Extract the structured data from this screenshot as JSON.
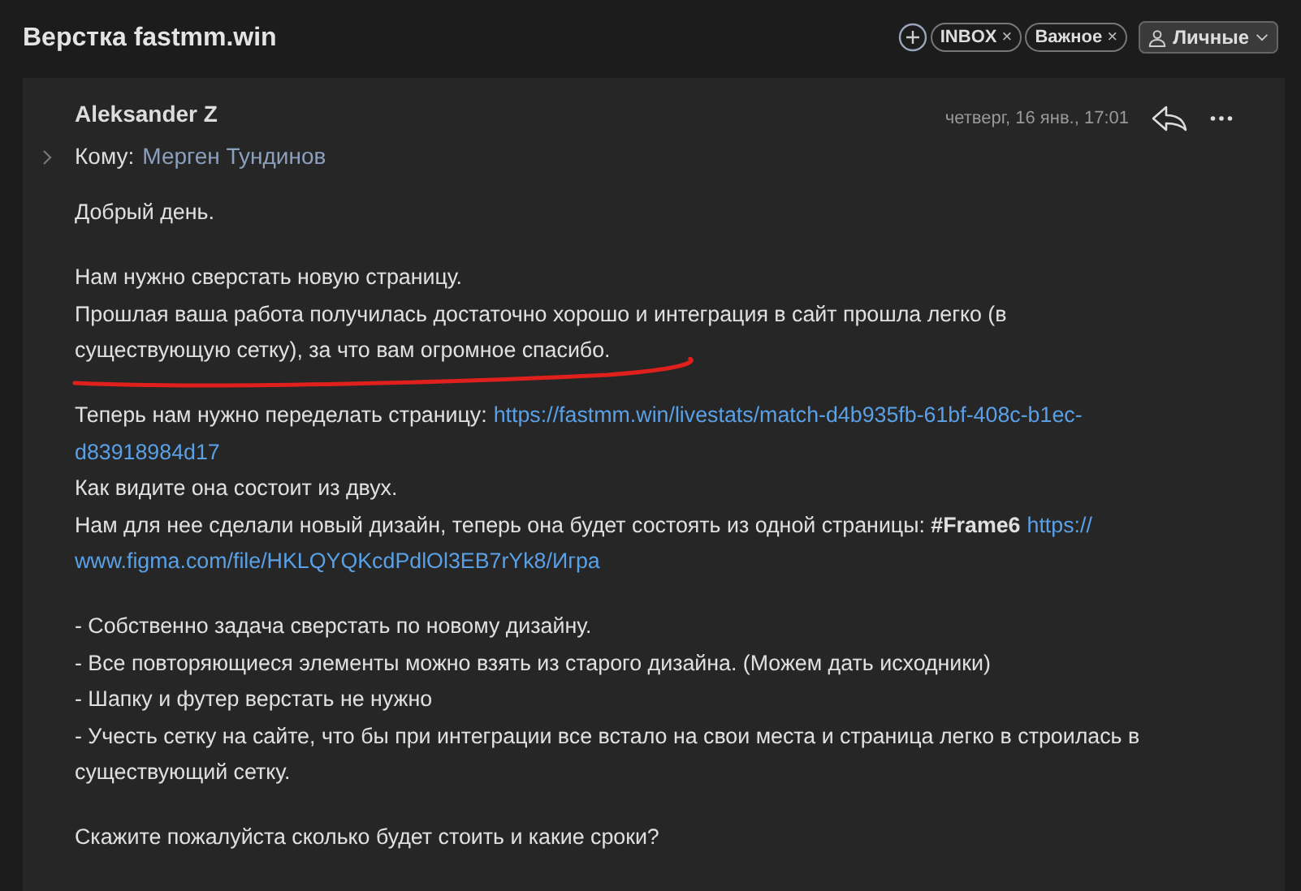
{
  "title": "Верстка fastmm.win",
  "tags": [
    {
      "label": "INBOX",
      "remove": "×"
    },
    {
      "label": "Важное",
      "remove": "×"
    }
  ],
  "account": {
    "label": "Личные"
  },
  "message": {
    "sender": "Aleksander Z",
    "to_label": "Кому:",
    "to": "Мерген Тундинов",
    "date": "четверг, 16 янв., 17:01",
    "paragraphs": [
      [
        [
          {
            "kind": "text",
            "text": "Добрый день."
          }
        ]
      ],
      [
        [
          {
            "kind": "text",
            "text": "Нам нужно сверстать новую страницу."
          }
        ],
        [
          {
            "kind": "text",
            "text": "Прошлая ваша работа получилась достаточно хорошо и интеграция в сайт прошла легко (в"
          }
        ],
        [
          {
            "kind": "text",
            "text": "существующую сетку), за что вам огромное спасибо."
          }
        ]
      ],
      [
        [
          {
            "kind": "text",
            "text": "Теперь нам нужно переделать страницу:"
          },
          {
            "kind": "link",
            "text": "https://fastmm.win/livestats/match-d4b935fb-61bf-408c-b1ec-"
          }
        ],
        [
          {
            "kind": "link",
            "text": "d83918984d17"
          }
        ],
        [
          {
            "kind": "text",
            "text": "Как видите она состоит из двух."
          }
        ],
        [
          {
            "kind": "text",
            "text": "Нам для нее сделали новый дизайн, теперь она будет состоять из одной страницы: **#Frame6**"
          },
          {
            "kind": "link",
            "text": "https://"
          }
        ],
        [
          {
            "kind": "link",
            "text": "www.figma.com/file/HKLQYQKcdPdlOl3EB7rYk8/Игра"
          }
        ]
      ],
      [
        [
          {
            "kind": "text",
            "text": "- Собственно задача сверстать по новому дизайну."
          }
        ],
        [
          {
            "kind": "text",
            "text": "- Все повторяющиеся элементы можно взять из старого дизайна. (Можем дать исходники)"
          }
        ],
        [
          {
            "kind": "text",
            "text": "- Шапку и футер верстать не нужно"
          }
        ],
        [
          {
            "kind": "text",
            "text": "- Учесть сетку на сайте, что бы при интеграции все встало на свои места и страница легко в строилась в"
          }
        ],
        [
          {
            "kind": "text",
            "text": "существующий сетку."
          }
        ]
      ],
      [
        [
          {
            "kind": "text",
            "text": "Скажите пожалуйста сколько будет стоить и какие сроки?"
          }
        ]
      ]
    ]
  }
}
